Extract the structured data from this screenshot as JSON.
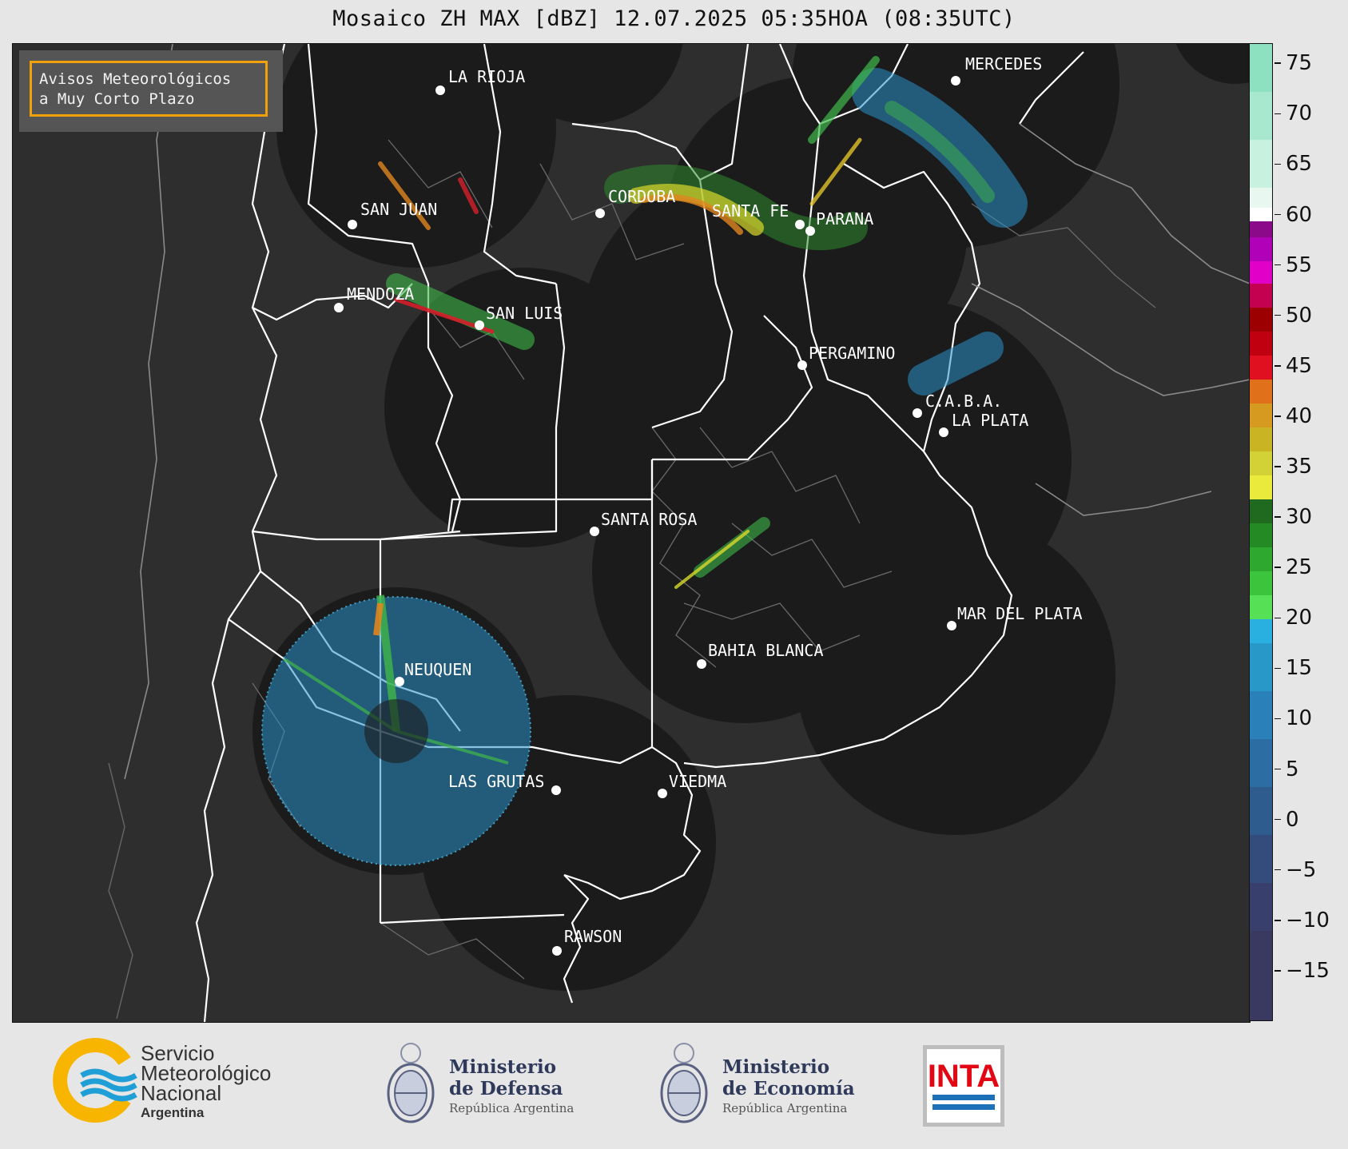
{
  "title": "Mosaico ZH MAX [dBZ] 12.07.2025 05:35HOA (08:35UTC)",
  "notice": {
    "line1": "Avisos Meteorológicos",
    "line2": "a Muy Corto Plazo",
    "border_color": "#f0a10a"
  },
  "cities": [
    {
      "label": "LA RIOJA"
    },
    {
      "label": "MERCEDES"
    },
    {
      "label": "SAN JUAN"
    },
    {
      "label": "CORDOBA"
    },
    {
      "label": "SANTA FE"
    },
    {
      "label": "PARANA"
    },
    {
      "label": "MENDOZA"
    },
    {
      "label": "SAN LUIS"
    },
    {
      "label": "PERGAMINO"
    },
    {
      "label": "C.A.B.A."
    },
    {
      "label": "LA PLATA"
    },
    {
      "label": "SANTA ROSA"
    },
    {
      "label": "MAR DEL PLATA"
    },
    {
      "label": "BAHIA BLANCA"
    },
    {
      "label": "NEUQUEN"
    },
    {
      "label": "LAS GRUTAS"
    },
    {
      "label": "VIEDMA"
    },
    {
      "label": "RAWSON"
    }
  ],
  "colorbar": {
    "unit": "dBZ",
    "min": -20,
    "max": 77,
    "ticks": [
      "75",
      "70",
      "65",
      "60",
      "55",
      "50",
      "45",
      "40",
      "35",
      "30",
      "25",
      "20",
      "15",
      "10",
      "5",
      "0",
      "−5",
      "−10",
      "−15"
    ],
    "tick_values": [
      75,
      70,
      65,
      60,
      55,
      50,
      45,
      40,
      35,
      30,
      25,
      20,
      15,
      10,
      5,
      0,
      -5,
      -10,
      -15
    ]
  },
  "footer": {
    "smn": {
      "line1": "Servicio",
      "line2": "Meteorológico",
      "line3": "Nacional",
      "line4": "Argentina",
      "blue": "#1f9fd6",
      "yellow": "#f7b500"
    },
    "defensa": {
      "line1": "Ministerio",
      "line2": "de Defensa",
      "line3": "República Argentina"
    },
    "economia": {
      "line1": "Ministerio",
      "line2": "de Economía",
      "line3": "República Argentina"
    },
    "inta": {
      "label": "INTA",
      "red": "#e30613",
      "blue": "#1d71b8"
    }
  }
}
